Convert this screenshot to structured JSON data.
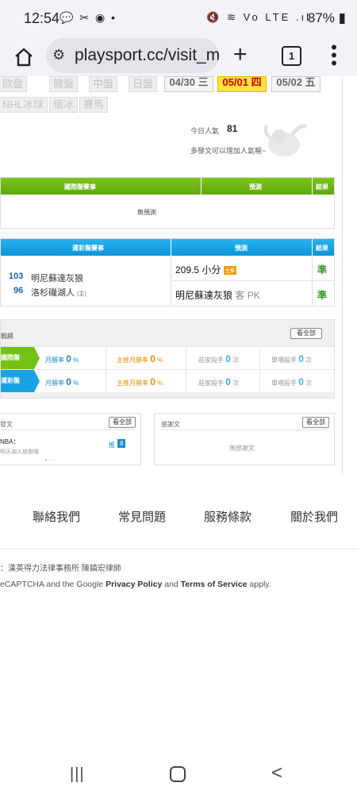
{
  "status_bar": {
    "time": "12:54",
    "left_icons": "💬 ✂ ◉ •",
    "right_icons": "🔇 ≋ Vo LTE .ıl",
    "battery": "87%"
  },
  "browser": {
    "url": "playsport.cc/visit_m",
    "tab_count": "1",
    "icons": [
      "home-icon",
      "site-settings-icon",
      "new-tab-icon",
      "tab-switcher-icon",
      "menu-icon"
    ]
  },
  "top": {
    "tags_row1": [
      "欧盘",
      "韓盤",
      "中盤",
      "日盤"
    ],
    "tags_row2": [
      "NHL冰球",
      "俄冰",
      "賽馬"
    ],
    "dates": [
      {
        "label": "04/30 三",
        "active": false
      },
      {
        "label": "05/01 四",
        "active": true
      },
      {
        "label": "05/02 五",
        "active": false
      }
    ],
    "popularity_label": "今日人氣",
    "popularity_value": "81",
    "popularity_hint": "多發文可以增加人氣喔~"
  },
  "intl_table": {
    "header_match": "國際盤賽事",
    "header_pred": "預測",
    "header_result": "結果",
    "empty": "無預測"
  },
  "lottery_table": {
    "header_match": "運彩盤賽事",
    "header_pred": "預測",
    "header_result": "結果",
    "away_score": "103",
    "away_team": "明尼蘇達灰狼",
    "home_score": "96",
    "home_team": "洛杉磯湖人",
    "home_mark": "(主)",
    "pred1": "209.5 小分",
    "pred1_badge": "主推",
    "pred2": "明尼蘇達灰狼",
    "pred2_sub": "客 PK",
    "result1": "準",
    "result2": "準"
  },
  "stats": {
    "title": "戰績",
    "view_all": "看全部",
    "rows": [
      {
        "tag": "國際盤",
        "month_rate_label": "月勝率",
        "month_rate": "0",
        "pct": "%",
        "main_month_label": "主推月勝率",
        "main_month": "0",
        "banker_label": "莊家殺手",
        "banker": "0",
        "times": "次",
        "single_label": "單場殺手",
        "single": "0"
      },
      {
        "tag": "運彩盤",
        "month_rate_label": "月勝率",
        "month_rate": "0",
        "pct": "%",
        "main_month_label": "主推月勝率",
        "main_month": "0",
        "banker_label": "莊家殺手",
        "banker": "0",
        "times": "次",
        "single_label": "單場殺手",
        "single": "0"
      }
    ]
  },
  "posts": {
    "title": "發文",
    "view_all": "看全部",
    "item_title": "NBA：",
    "item_sub": "明天湖人放假囉",
    "push_label": "推",
    "push_count": "8"
  },
  "thanks": {
    "title": "感謝文",
    "view_all": "看全部",
    "empty": "無感謝文"
  },
  "footer": {
    "links": [
      "聯絡我們",
      "常見問題",
      "服務條款",
      "關於我們"
    ],
    "lawyer": "：漢英得力法律事務所 陳鎮宏律師",
    "recaptcha_pre": "eCAPTCHA and the Google ",
    "privacy": "Privacy Policy",
    "and": " and ",
    "terms": "Terms of Service",
    "apply": " apply."
  },
  "nav": {
    "recent": "|||",
    "back": "<"
  }
}
